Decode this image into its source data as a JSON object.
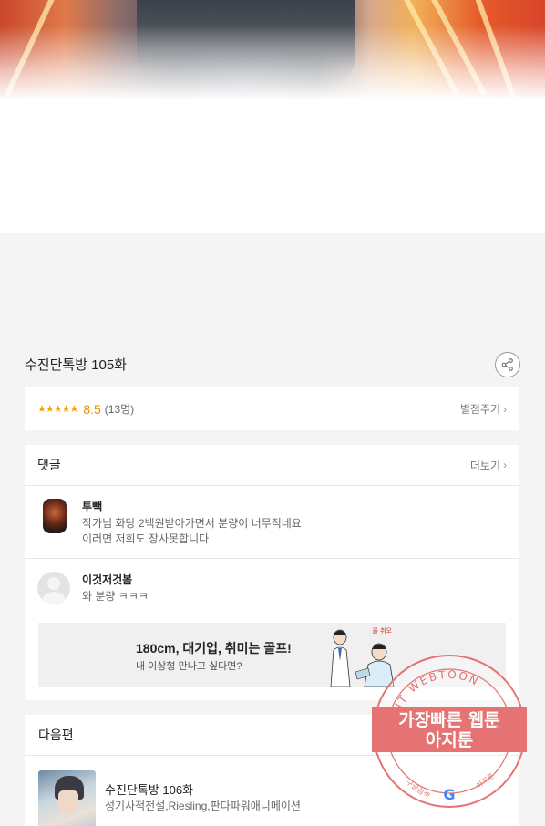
{
  "episode": {
    "title": "수진단톡방 105화",
    "share_icon": "share-icon"
  },
  "rating": {
    "stars": "★★★★★",
    "score_value": 8.5,
    "score": "8.5",
    "count": "(13명)",
    "rate_link": "별점주기",
    "star_color": "#f4a300"
  },
  "comments": {
    "header": "댓글",
    "more_link": "더보기",
    "items": [
      {
        "name": "투빽",
        "text_line1": "작가님 화당 2백원받아가면서 분량이 너무적네요",
        "text_line2": "이러면 저희도 장사못합니다"
      },
      {
        "name": "이것저것봄",
        "text_line1": "와 분량 ㅋㅋㅋ",
        "text_line2": ""
      }
    ]
  },
  "ad": {
    "title": "180cm, 대기업, 취미는 골프!",
    "subtitle": "내 이상형 만나고 싶다면?",
    "art_label": "올 취오"
  },
  "next": {
    "header": "다음편",
    "title": "수진단톡방 106화",
    "meta": "성기사적전설,Riesling,판다파워애니메이션"
  },
  "watermark": {
    "ring_text": "AGIT WEBTOON",
    "line1": "가장빠른 웹툰",
    "line2": "아지툰",
    "bottom_left": "구글검색",
    "bottom_right": "아지툰",
    "color": "#e57373"
  }
}
